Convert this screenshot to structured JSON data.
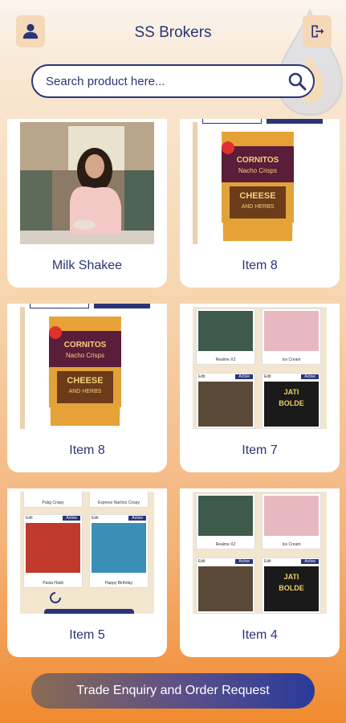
{
  "header": {
    "title": "SS Brokers",
    "profile_icon": "person-icon",
    "logout_icon": "logout-icon"
  },
  "search": {
    "placeholder": "Search product here..."
  },
  "products": [
    {
      "name": "Milk Shakee",
      "image": "woman-kitchen-photo"
    },
    {
      "name": "Item 8",
      "image": "cornitos-nacho-crisps-pack"
    },
    {
      "name": "Item 8",
      "image": "cornitos-nacho-crisps-pack"
    },
    {
      "name": "Item 7",
      "image": "app-screenshot-collage"
    },
    {
      "name": "Item 5",
      "image": "app-screenshot-collage"
    },
    {
      "name": "Item 4",
      "image": "app-screenshot-collage"
    }
  ],
  "collage": {
    "edit": "Edit",
    "active": "Active",
    "realme": "Realme X2",
    "icecream": "Ice Cream",
    "pubg": "Pubg Crispy",
    "express": "Express Nachos Crispy",
    "pasta": "Pasta Haldi",
    "birthday": "Happy Birthday",
    "jatti1": "JATI",
    "jatti2": "BOLDE"
  },
  "pack": {
    "brand": "CORNITOS",
    "line": "Nacho Crisps",
    "flavor1": "CHEESE",
    "flavor2": "AND HERBS"
  },
  "footer": {
    "cta_label": "Trade Enquiry and Order Request"
  },
  "colors": {
    "primary": "#2a3578",
    "accent": "#f08a2e"
  }
}
